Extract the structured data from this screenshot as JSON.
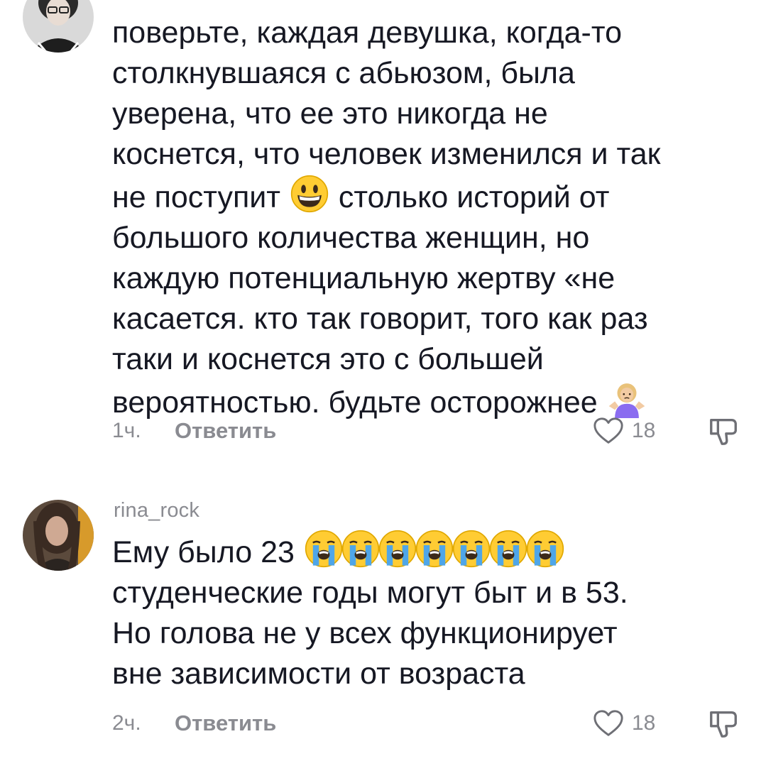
{
  "comments": [
    {
      "username": "",
      "text_lines": [
        "поверьте, каждая девушка, когда-то",
        "столкнувшаяся с абьюзом, была",
        "уверена, что ее это никогда не",
        "коснется, что человек изменился и так",
        "не поступит",
        "столько историй от",
        "большого количества женщин, но",
        "каждую потенциальную жертву «не",
        "касается. кто так говорит, того как раз",
        "таки и коснется это с большей",
        "вероятностью. будьте осторожнее"
      ],
      "emojis": [
        "grinning-face",
        "woman-shrugging"
      ],
      "time": "1ч.",
      "reply_label": "Ответить",
      "likes": "18"
    },
    {
      "username": "rina_rock",
      "text_lines": [
        "Ему было 23",
        "студенческие годы могут быт и в 53.",
        "Но голова не у всех функционирует",
        "вне зависимости от возраста"
      ],
      "emojis": [
        "loudly-crying-face",
        "loudly-crying-face",
        "loudly-crying-face",
        "loudly-crying-face",
        "loudly-crying-face",
        "loudly-crying-face",
        "loudly-crying-face"
      ],
      "time": "2ч.",
      "reply_label": "Ответить",
      "likes": "18"
    }
  ],
  "colors": {
    "text": "#161823",
    "secondary": "#8a8b91",
    "background": "#ffffff"
  },
  "icons": [
    "heart-icon",
    "dislike-icon"
  ]
}
